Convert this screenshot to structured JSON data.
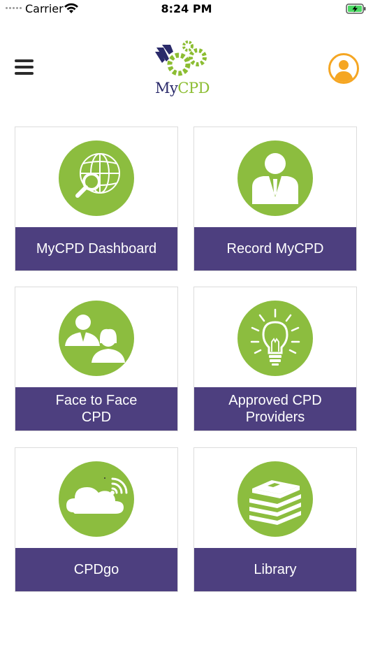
{
  "status_bar": {
    "carrier": "Carrier",
    "time": "8:24 PM"
  },
  "header": {
    "logo_my": "My",
    "logo_cpd": "CPD"
  },
  "colors": {
    "tile_label_bg": "#4d3f7f",
    "icon_green": "#8cbd3f",
    "profile_orange": "#f5a623"
  },
  "tiles": [
    {
      "label": "MyCPD Dashboard",
      "icon": "globe-search-icon"
    },
    {
      "label": "Record MyCPD",
      "icon": "person-suit-icon"
    },
    {
      "label": "Face to Face CPD",
      "icon": "people-icon"
    },
    {
      "label": "Approved CPD Providers",
      "icon": "lightbulb-icon"
    },
    {
      "label": "CPDgo",
      "icon": "cloud-icon"
    },
    {
      "label": "Library",
      "icon": "books-icon"
    }
  ]
}
